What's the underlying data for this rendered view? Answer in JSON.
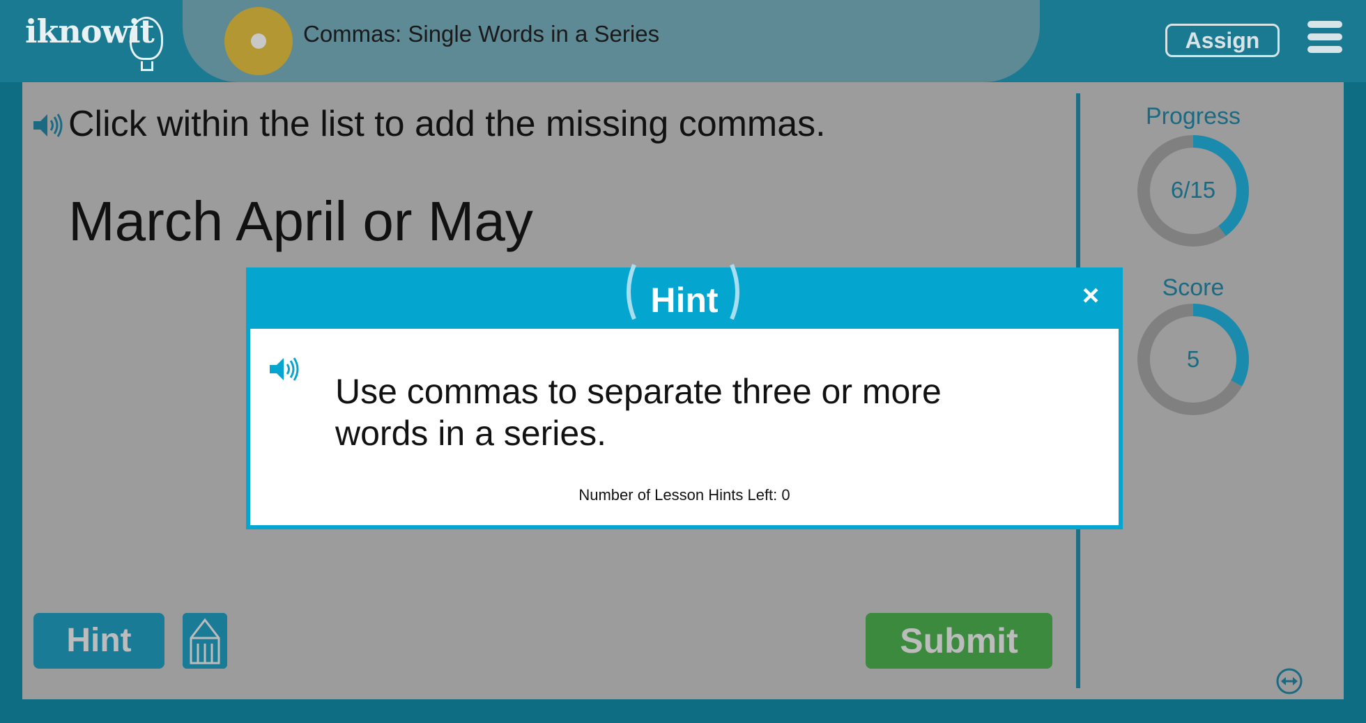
{
  "header": {
    "logo_text": "iknowit",
    "lesson_title": "Commas: Single Words in a Series",
    "assign_label": "Assign"
  },
  "question": {
    "prompt": "Click within the list to add the missing commas.",
    "series_text": "March April or May"
  },
  "sidebar": {
    "progress_label": "Progress",
    "progress_value": "6/15",
    "progress_fraction": 0.4,
    "score_label": "Score",
    "score_value": "5",
    "score_fraction": 0.33
  },
  "footer": {
    "hint_label": "Hint",
    "submit_label": "Submit"
  },
  "hint_modal": {
    "title": "Hint",
    "close_label": "×",
    "text": "Use commas to separate three or more words in a series.",
    "hints_left": "Number of Lesson Hints Left: 0"
  },
  "colors": {
    "accent": "#04a5cf",
    "dark_teal": "#1b6a82",
    "submit_green": "#3b8a3e",
    "disc_gold": "#b39732"
  }
}
